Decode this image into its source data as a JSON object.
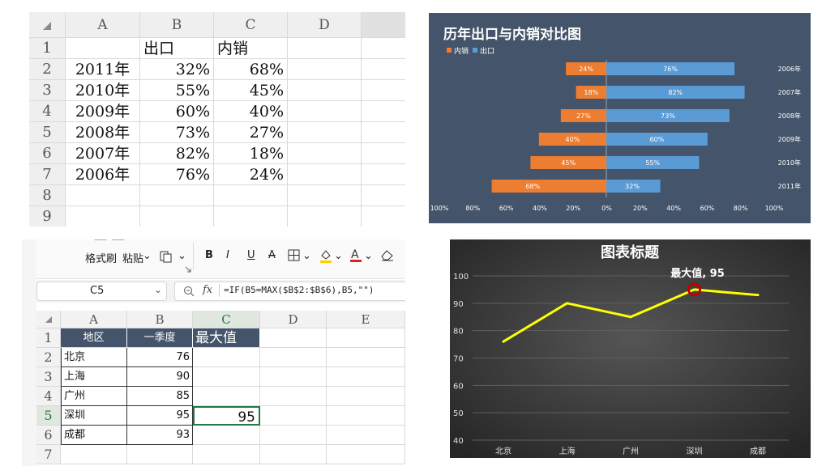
{
  "excel1": {
    "cols": [
      "A",
      "B",
      "C",
      "D"
    ],
    "rows": [
      "1",
      "2",
      "3",
      "4",
      "5",
      "6",
      "7",
      "8",
      "9"
    ],
    "data": [
      [
        "",
        "出口",
        "内销"
      ],
      [
        "2011年",
        "32%",
        "68%"
      ],
      [
        "2010年",
        "55%",
        "45%"
      ],
      [
        "2009年",
        "60%",
        "40%"
      ],
      [
        "2008年",
        "73%",
        "27%"
      ],
      [
        "2007年",
        "82%",
        "18%"
      ],
      [
        "2006年",
        "76%",
        "24%"
      ]
    ]
  },
  "chart_data": [
    {
      "type": "bar",
      "title": "历年出口与内销对比图",
      "legend": [
        "内销",
        "出口"
      ],
      "legend_position": "top-left",
      "categories": [
        "2006年",
        "2007年",
        "2008年",
        "2009年",
        "2010年",
        "2011年"
      ],
      "series": [
        {
          "name": "内销",
          "values": [
            24,
            18,
            27,
            40,
            45,
            68
          ],
          "color": "#ed7d31"
        },
        {
          "name": "出口",
          "values": [
            76,
            82,
            73,
            60,
            55,
            32
          ],
          "color": "#5b9bd5"
        }
      ],
      "xticks": [
        "100%",
        "80%",
        "60%",
        "40%",
        "20%",
        "0%",
        "20%",
        "40%",
        "60%",
        "80%",
        "100%"
      ],
      "background": "#44546a"
    },
    {
      "type": "line",
      "title": "图表标题",
      "categories": [
        "北京",
        "上海",
        "广州",
        "深圳",
        "成都"
      ],
      "values": [
        76,
        90,
        85,
        95,
        93
      ],
      "ylim": [
        40,
        100
      ],
      "yticks": [
        "100",
        "90",
        "80",
        "70",
        "60",
        "50",
        "40"
      ],
      "annotation": "最大值, 95",
      "line_color": "#ffff00",
      "marker_color": "#c00000",
      "grid": true,
      "background": "#404040"
    }
  ],
  "excel2": {
    "ribbon": {
      "format_painter": "格式刷",
      "paste": "粘贴",
      "bold": "B",
      "italic": "I",
      "underline": "U",
      "strike": "A"
    },
    "namebox": "C5",
    "fx_label": "fx",
    "formula": "=IF(B5=MAX($B$2:$B$6),B5,\"\")",
    "cols": [
      "A",
      "B",
      "C",
      "D",
      "E"
    ],
    "rows": [
      "1",
      "2",
      "3",
      "4",
      "5",
      "6",
      "7"
    ],
    "headers": [
      "地区",
      "一季度",
      "最大值"
    ],
    "data": [
      [
        "北京",
        "76",
        ""
      ],
      [
        "上海",
        "90",
        ""
      ],
      [
        "广州",
        "85",
        ""
      ],
      [
        "深圳",
        "95",
        "95"
      ],
      [
        "成都",
        "93",
        ""
      ]
    ],
    "header_color": "#44546a"
  }
}
